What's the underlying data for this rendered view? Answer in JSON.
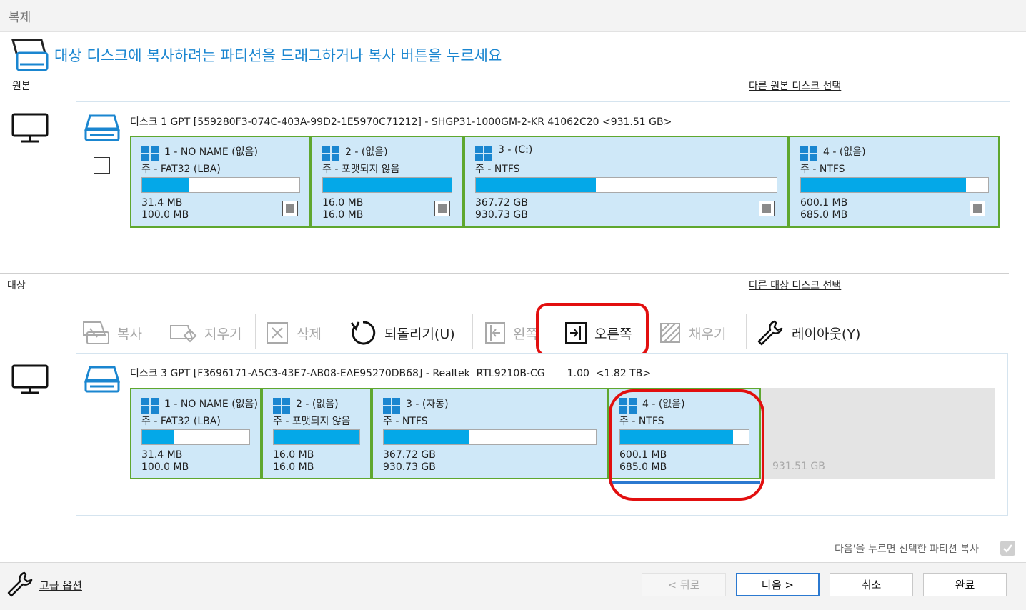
{
  "window": {
    "title": "복제"
  },
  "header": {
    "instruction": "대상 디스크에 복사하려는 파티션을 드래그하거나 복사 버튼을 누르세요"
  },
  "source": {
    "section_label": "원본",
    "select_link": "다른 원본 디스크 선택",
    "disk_title": "디스크 1 GPT [559280F3-074C-403A-99D2-1E5970C71212] - SHGP31-1000GM-2-KR 41062C20  <931.51 GB>",
    "partitions": [
      {
        "name": "1 - NO NAME (없음)",
        "type": "주 - FAT32 (LBA)",
        "used": "31.4 MB",
        "total": "100.0 MB",
        "fill_fraction": 0.3
      },
      {
        "name": "2 - (없음)",
        "type": "주 - 포맷되지 않음",
        "used": "16.0 MB",
        "total": "16.0 MB",
        "fill_fraction": 1.0
      },
      {
        "name": "3 - (C:)",
        "type": "주 - NTFS",
        "used": "367.72 GB",
        "total": "930.73 GB",
        "fill_fraction": 0.4
      },
      {
        "name": "4 - (없음)",
        "type": "주 - NTFS",
        "used": "600.1 MB",
        "total": "685.0 MB",
        "fill_fraction": 0.88
      }
    ]
  },
  "target": {
    "section_label": "대상",
    "select_link": "다른 대상 디스크 선택",
    "disk_title": "디스크 3 GPT [F3696171-A5C3-43E7-AB08-EAE95270DB68] - Realtek  RTL9210B-CG       1.00  <1.82 TB>",
    "partitions": [
      {
        "name": "1 - NO NAME (없음)",
        "type": "주 - FAT32 (LBA)",
        "used": "31.4 MB",
        "total": "100.0 MB",
        "fill_fraction": 0.3
      },
      {
        "name": "2 - (없음)",
        "type": "주 - 포맷되지 않음",
        "used": "16.0 MB",
        "total": "16.0 MB",
        "fill_fraction": 1.0
      },
      {
        "name": "3 - (자동)",
        "type": "주 - NTFS",
        "used": "367.72 GB",
        "total": "930.73 GB",
        "fill_fraction": 0.4
      },
      {
        "name": "4 - (없음)",
        "type": "주 - NTFS",
        "used": "600.1 MB",
        "total": "685.0 MB",
        "fill_fraction": 0.88
      }
    ],
    "unallocated": "931.51 GB"
  },
  "toolbar": {
    "copy": "복사",
    "erase": "지우기",
    "delete": "삭제",
    "undo": "되돌리기(U)",
    "left": "왼쪽",
    "right": "오른쪽",
    "fill": "채우기",
    "layout": "레이아웃(Y)"
  },
  "footer": {
    "note": "다음'을 누르면 선택한 파티션 복사",
    "advanced": "고급 옵션",
    "back": "< 뒤로",
    "next": "다음 >",
    "cancel": "취소",
    "finish": "완료"
  },
  "colors": {
    "accent": "#1a86d0",
    "partition_bg": "#cfe8f8",
    "partition_border": "#5fa72f",
    "usage_fill": "#04a8e8",
    "highlight": "#e20f0f"
  }
}
